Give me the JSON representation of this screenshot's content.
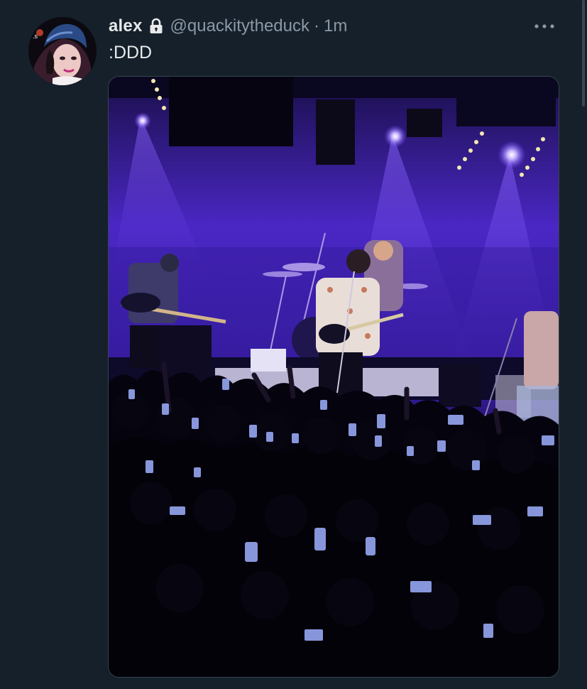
{
  "tweet": {
    "author_name": "alex",
    "handle": "@quackitytheduck",
    "separator": "·",
    "time": "1m",
    "text": ":DDD",
    "protected_icon": "lock-icon",
    "more_icon": "more-horizontal-icon",
    "media_description_icon": "photo"
  },
  "colors": {
    "background": "#15202b",
    "primary_text": "#e7e9ea",
    "secondary_text": "#8b98a5",
    "border": "#38444d",
    "stage_purple": "#5a2fd6"
  }
}
